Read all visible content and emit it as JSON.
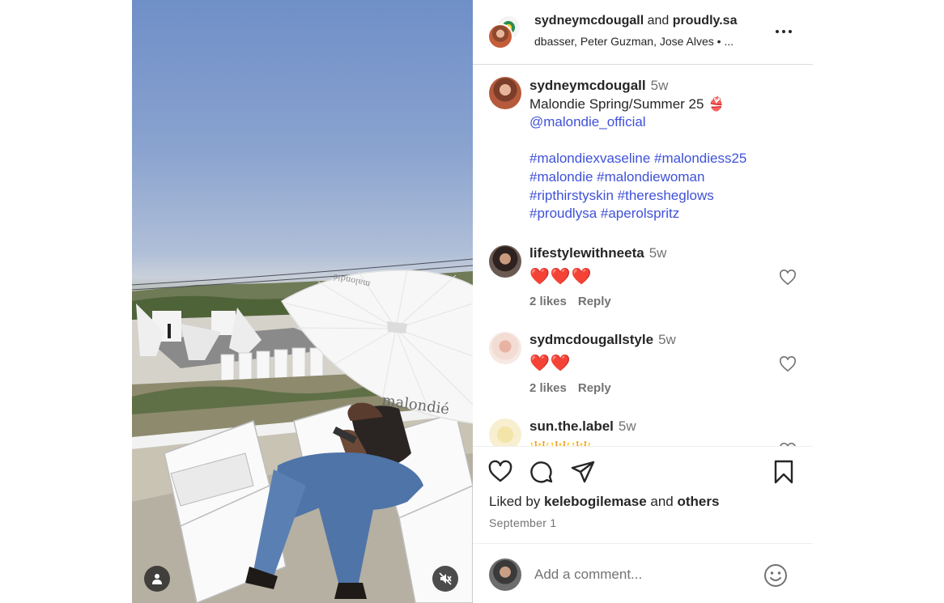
{
  "header": {
    "author": "sydneymcdougall",
    "joiner": " and ",
    "collaborator": "proudly.sa",
    "subtitle": "dbasser, Peter Guzman, Jose Alves  •   ..."
  },
  "caption": {
    "username": "sydneymcdougall",
    "time": "5w",
    "lines": [
      "Malondie Spring/Summer 25 👙",
      "@malondie_official",
      "",
      "#malondiexvaseline #malondiess25",
      "#malondie #malondiewoman",
      "#ripthirstyskin #theresheglows",
      "#proudlysa #aperolspritz"
    ]
  },
  "comments": [
    {
      "username": "lifestylewithneeta",
      "time": "5w",
      "text": "❤️❤️❤️",
      "likes": "2 likes",
      "reply": "Reply"
    },
    {
      "username": "sydmcdougallstyle",
      "time": "5w",
      "text": "❤️❤️",
      "likes": "2 likes",
      "reply": "Reply"
    },
    {
      "username": "sun.the.label",
      "time": "5w",
      "text": "👑👑👑",
      "likes": "",
      "reply": ""
    }
  ],
  "media": {
    "umbrella_text": "malondié",
    "umbrella_text_top": "malondié"
  },
  "likes": {
    "prefix": "Liked by ",
    "user": "kelebogilemase",
    "joiner": " and ",
    "others": "others"
  },
  "date": "September 1",
  "comment_input": {
    "placeholder": "Add a comment..."
  },
  "colors": {
    "link": "#3f51d9",
    "muted": "#737373",
    "text": "#262626",
    "border": "#dbdbdb"
  },
  "icons": [
    "more-icon",
    "heart-icon",
    "comment-icon",
    "share-icon",
    "bookmark-icon",
    "emoji-icon",
    "user-tag-icon",
    "muted-speaker-icon"
  ]
}
